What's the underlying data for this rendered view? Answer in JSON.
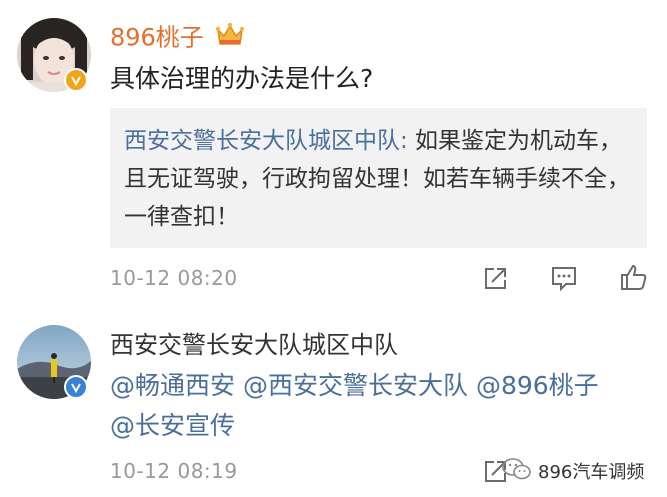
{
  "comment1": {
    "username": "896桃子",
    "text": "具体治理的办法是什么?",
    "quote": {
      "author": "西安交警长安大队城区中队",
      "separator": ":",
      "text": " 如果鉴定为机动车，且无证驾驶，行政拘留处理！如若车辆手续不全，一律查扣！"
    },
    "time": "10-12 08:20",
    "icons": {
      "crown": "crown-icon",
      "verified": "verified-badge-icon",
      "share": "share-icon",
      "comment": "comment-icon",
      "like": "like-icon"
    },
    "colors": {
      "verified_badge": "#f0a51f"
    }
  },
  "comment2": {
    "username": "西安交警长安大队城区中队",
    "mentions_line1": [
      "@畅通西安",
      "@西安交警长安大队",
      "@896桃子"
    ],
    "mentions_line2": [
      "@长安宣传"
    ],
    "time": "10-12 08:19",
    "icons": {
      "verified": "verified-badge-icon",
      "share": "share-icon",
      "comment": "comment-icon",
      "like": "like-icon"
    },
    "colors": {
      "verified_badge": "#3a82d6"
    }
  },
  "watermark": {
    "text": "896汽车调频",
    "icon": "wechat-icon"
  },
  "colors": {
    "link": "#4a6f9d",
    "username": "#e0712c",
    "muted": "#999999",
    "quote_bg": "#f2f2f2"
  }
}
